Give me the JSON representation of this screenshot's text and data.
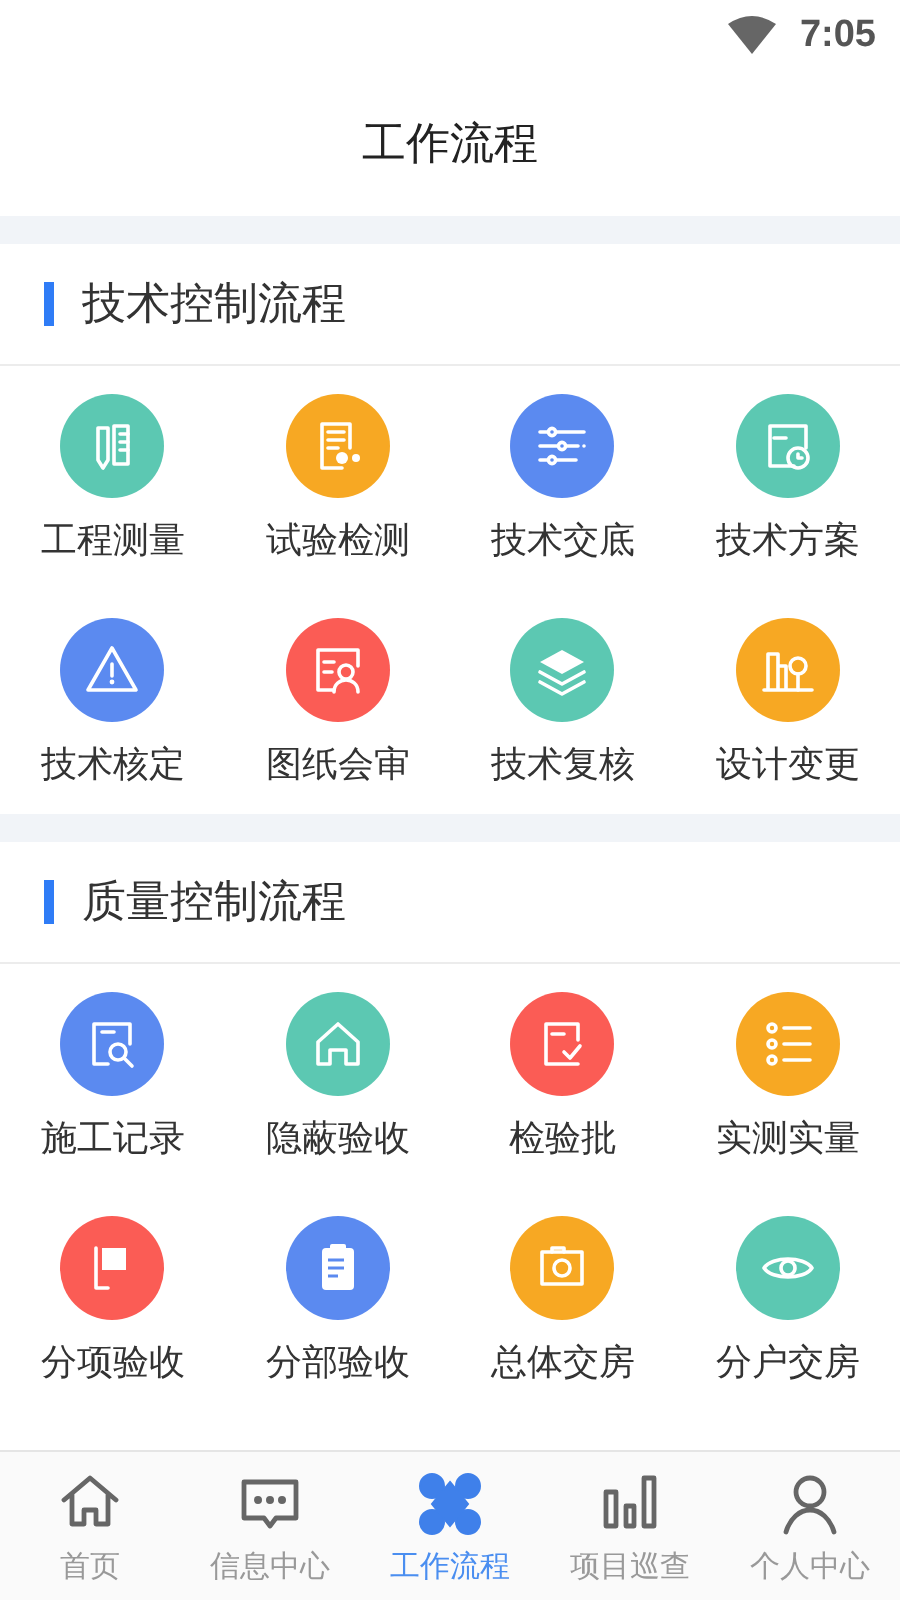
{
  "status_bar": {
    "time": "7:05"
  },
  "header": {
    "title": "工作流程"
  },
  "sections": [
    {
      "title": "技术控制流程",
      "items": [
        {
          "label": "工程测量",
          "color": "#5cc8b2"
        },
        {
          "label": "试验检测",
          "color": "#f7a823"
        },
        {
          "label": "技术交底",
          "color": "#5b8af0"
        },
        {
          "label": "技术方案",
          "color": "#5cc8b2"
        },
        {
          "label": "技术核定",
          "color": "#5b8af0"
        },
        {
          "label": "图纸会审",
          "color": "#fb5c55"
        },
        {
          "label": "技术复核",
          "color": "#5cc8b2"
        },
        {
          "label": "设计变更",
          "color": "#f7a823"
        }
      ]
    },
    {
      "title": "质量控制流程",
      "items": [
        {
          "label": "施工记录",
          "color": "#5b8af0"
        },
        {
          "label": "隐蔽验收",
          "color": "#5cc8b2"
        },
        {
          "label": "检验批",
          "color": "#fb5c55"
        },
        {
          "label": "实测实量",
          "color": "#f7a823"
        },
        {
          "label": "分项验收",
          "color": "#fb5c55"
        },
        {
          "label": "分部验收",
          "color": "#5b8af0"
        },
        {
          "label": "总体交房",
          "color": "#f7a823"
        },
        {
          "label": "分户交房",
          "color": "#5cc8b2"
        }
      ]
    }
  ],
  "tab_bar": [
    {
      "label": "首页",
      "selected": false
    },
    {
      "label": "信息中心",
      "selected": false
    },
    {
      "label": "工作流程",
      "selected": true
    },
    {
      "label": "项目巡查",
      "selected": false
    },
    {
      "label": "个人中心",
      "selected": false
    }
  ]
}
